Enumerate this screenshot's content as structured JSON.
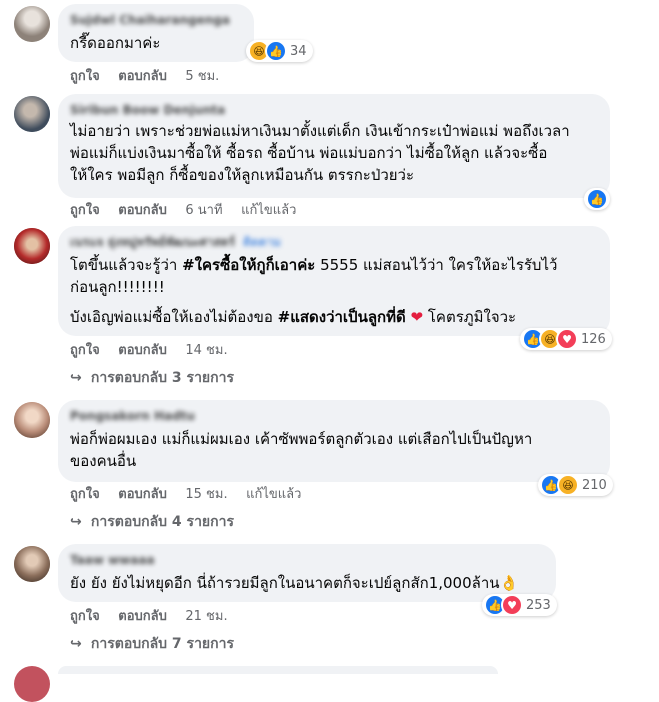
{
  "actions": {
    "like": "ถูกใจ",
    "reply": "ตอบกลับ",
    "edited": "แก้ไขแล้ว"
  },
  "colors": {
    "bubble": "#f0f2f5",
    "meta": "#65676b",
    "like": "#1877f2",
    "haha": "#f7b125",
    "love": "#f33e58",
    "heart": "#e41e3f"
  },
  "reaction_icons": [
    "like-icon",
    "haha-icon",
    "love-icon",
    "reply-arrow-icon"
  ],
  "comments": [
    {
      "author": "Sujdwl Chaiharangenga",
      "text": "กรี๊ดออกมาค่ะ",
      "time": "5 ชม.",
      "reactions_count": "34"
    },
    {
      "author": "Siribun Boow Denjunta",
      "text": "ไม่อายว่า เพราะช่วยพ่อแม่หาเงินมาตั้งแต่เด็ก เงินเข้ากระเป๋าพ่อแม่ พอถึงเวลา\nพ่อแม่ก็แบ่งเงินมาซื้อให้ ซื้อรถ ซื้อบ้าน พ่อแม่บอกว่า ไม่ซื้อให้ลูก แล้วจะซื้อ\nให้ใคร พอมีลูก ก็ซื้อของให้ลูกเหมือนกัน ตรรกะป่วยว่ะ",
      "time": "6 นาที"
    },
    {
      "author": "เนรแจ ยุ่งหมู่ทรัพย์พัฒนะศาสตร์",
      "follow": "ติดตาม",
      "text_part1": "โตขึ้นแล้วจะรู้ว่า ",
      "hashtag1": "#ใครซื้อให้กูก็เอาค่ะ",
      "text_part2": " 5555 แม่สอนไว้ว่า ใครให้อะไรรับไว้\nก่อนลูก!!!!!!!!",
      "text_part3": "บังเอิญพ่อแม่ซื้อให้เองไม่ต้องขอ ",
      "hashtag2": "#แสดงว่าเป็นลูกที่ดี",
      "text_part4": " โคตรภูมิใจวะ",
      "time": "14 ชม.",
      "reactions_count": "126",
      "replies": "การตอบกลับ 3 รายการ"
    },
    {
      "author": "Pongsakorn Hadtu",
      "text": "พ่อก็พ่อผมเอง แม่ก็แม่ผมเอง เค้าซัพพอร์ตลูกตัวเอง แต่เสือกไปเป็นปัญหา\nของคนอื่น",
      "time": "15 ชม.",
      "reactions_count": "210",
      "replies": "การตอบกลับ 4 รายการ"
    },
    {
      "author": "Taaw wwaaa",
      "text": "ยัง ยัง ยังไม่หยุดอีก นี่ถ้ารวยมีลูกในอนาคตก็จะเปย์ลูกสัก1,000ล้าน👌",
      "time": "21 ชม.",
      "reactions_count": "253",
      "replies": "การตอบกลับ 7 รายการ"
    }
  ]
}
